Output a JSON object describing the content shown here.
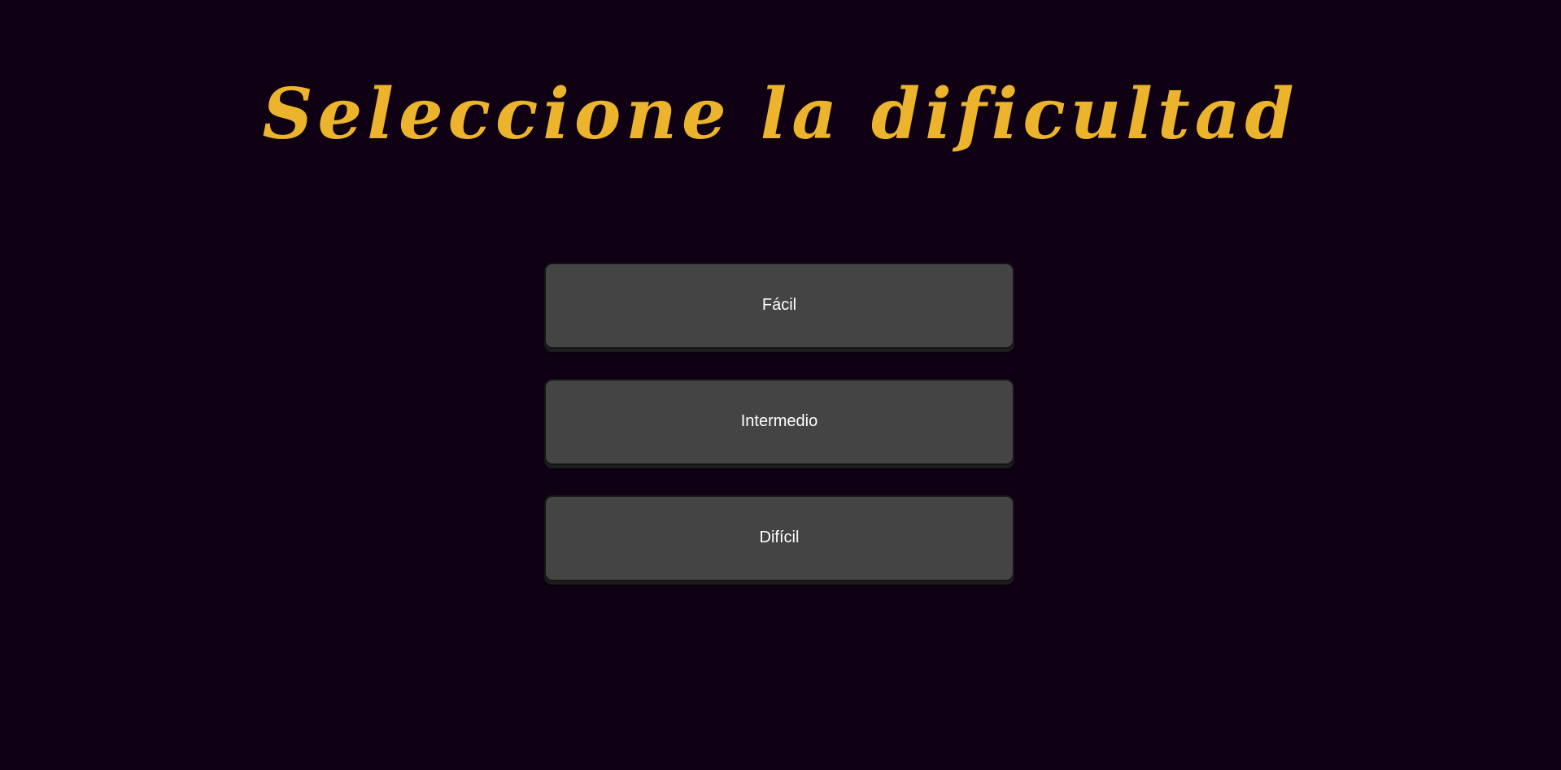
{
  "header": {
    "title": "Seleccione la dificultad",
    "title_color": "#ebb42c"
  },
  "difficulty": {
    "options": [
      {
        "label": "Fácil"
      },
      {
        "label": "Intermedio"
      },
      {
        "label": "Difícil"
      }
    ]
  },
  "theme": {
    "background": "#0f0014",
    "button_background": "#444444",
    "button_text": "#ffffff"
  }
}
